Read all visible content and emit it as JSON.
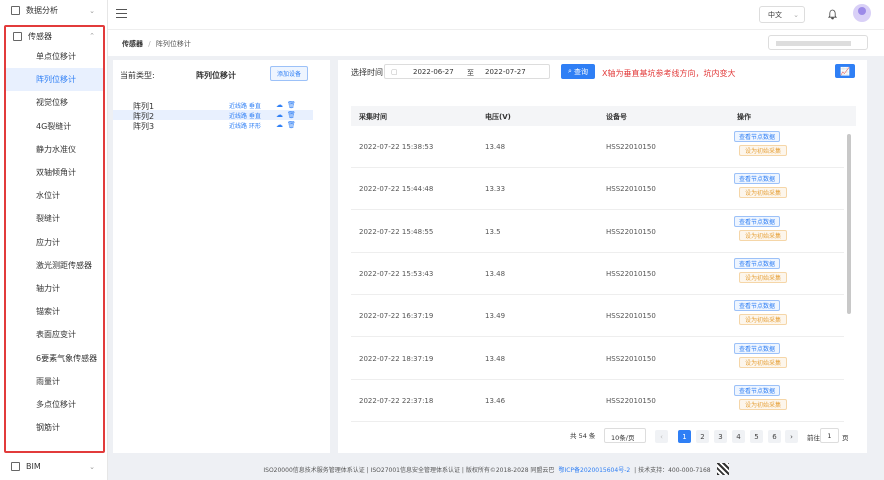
{
  "sidebar": {
    "top_item": "数据分析",
    "group_label": "传感器",
    "items": [
      "单点位移计",
      "阵列位移计",
      "视觉位移",
      "4G裂缝计",
      "静力水准仪",
      "双轴倾角计",
      "水位计",
      "裂缝计",
      "应力计",
      "激光测距传感器",
      "轴力计",
      "锚索计",
      "表面应变计",
      "6要素气象传感器",
      "雨量计",
      "多点位移计",
      "钢筋计"
    ],
    "active_index": 1,
    "bottom_item": "BIM"
  },
  "header": {
    "language": "中文"
  },
  "breadcrumb": {
    "root": "传感器",
    "sep": "/",
    "current": "阵列位移计"
  },
  "left_panel": {
    "current_type_label": "当前类型:",
    "current_type_value": "阵列位移计",
    "add_button": "添加设备",
    "arrays": [
      {
        "name": "阵列1",
        "links": "近线路 垂直"
      },
      {
        "name": "阵列2",
        "links": "近线路 垂直"
      },
      {
        "name": "阵列3",
        "links": "近线路 环形"
      }
    ],
    "active_array": 1
  },
  "filter": {
    "label": "选择时间",
    "start": "2022-06-27",
    "to": "至",
    "end": "2022-07-27",
    "query_button": "查询",
    "note": "X轴为垂直基坑参考线方向，坑内变大"
  },
  "table": {
    "headers": [
      "采集时间",
      "电压(V)",
      "设备号",
      "操作"
    ],
    "rows": [
      {
        "time": "2022-07-22 15:38:53",
        "voltage": "13.48",
        "device": "HSS22010150"
      },
      {
        "time": "2022-07-22 15:44:48",
        "voltage": "13.33",
        "device": "HSS22010150"
      },
      {
        "time": "2022-07-22 15:48:55",
        "voltage": "13.5",
        "device": "HSS22010150"
      },
      {
        "time": "2022-07-22 15:53:43",
        "voltage": "13.48",
        "device": "HSS22010150"
      },
      {
        "time": "2022-07-22 16:37:19",
        "voltage": "13.49",
        "device": "HSS22010150"
      },
      {
        "time": "2022-07-22 18:37:19",
        "voltage": "13.48",
        "device": "HSS22010150"
      },
      {
        "time": "2022-07-22 22:37:18",
        "voltage": "13.46",
        "device": "HSS22010150"
      }
    ],
    "op_view": "查看节点数据",
    "op_set": "设为初始采集"
  },
  "pagination": {
    "total": "共 54 条",
    "page_size": "10条/页",
    "pages": [
      "1",
      "2",
      "3",
      "4",
      "5",
      "6"
    ],
    "current": "1",
    "goto_label": "前往",
    "goto_value": "1",
    "page_unit": "页"
  },
  "footer": {
    "text": "ISO20000信息技术服务管理体系认证 | ISO27001信息安全管理体系认证 | 版权所有©2018-2028 同盟云巴",
    "icp": "鄂ICP备2020015604号-2",
    "support": "| 技术支持：400-000-7168"
  }
}
